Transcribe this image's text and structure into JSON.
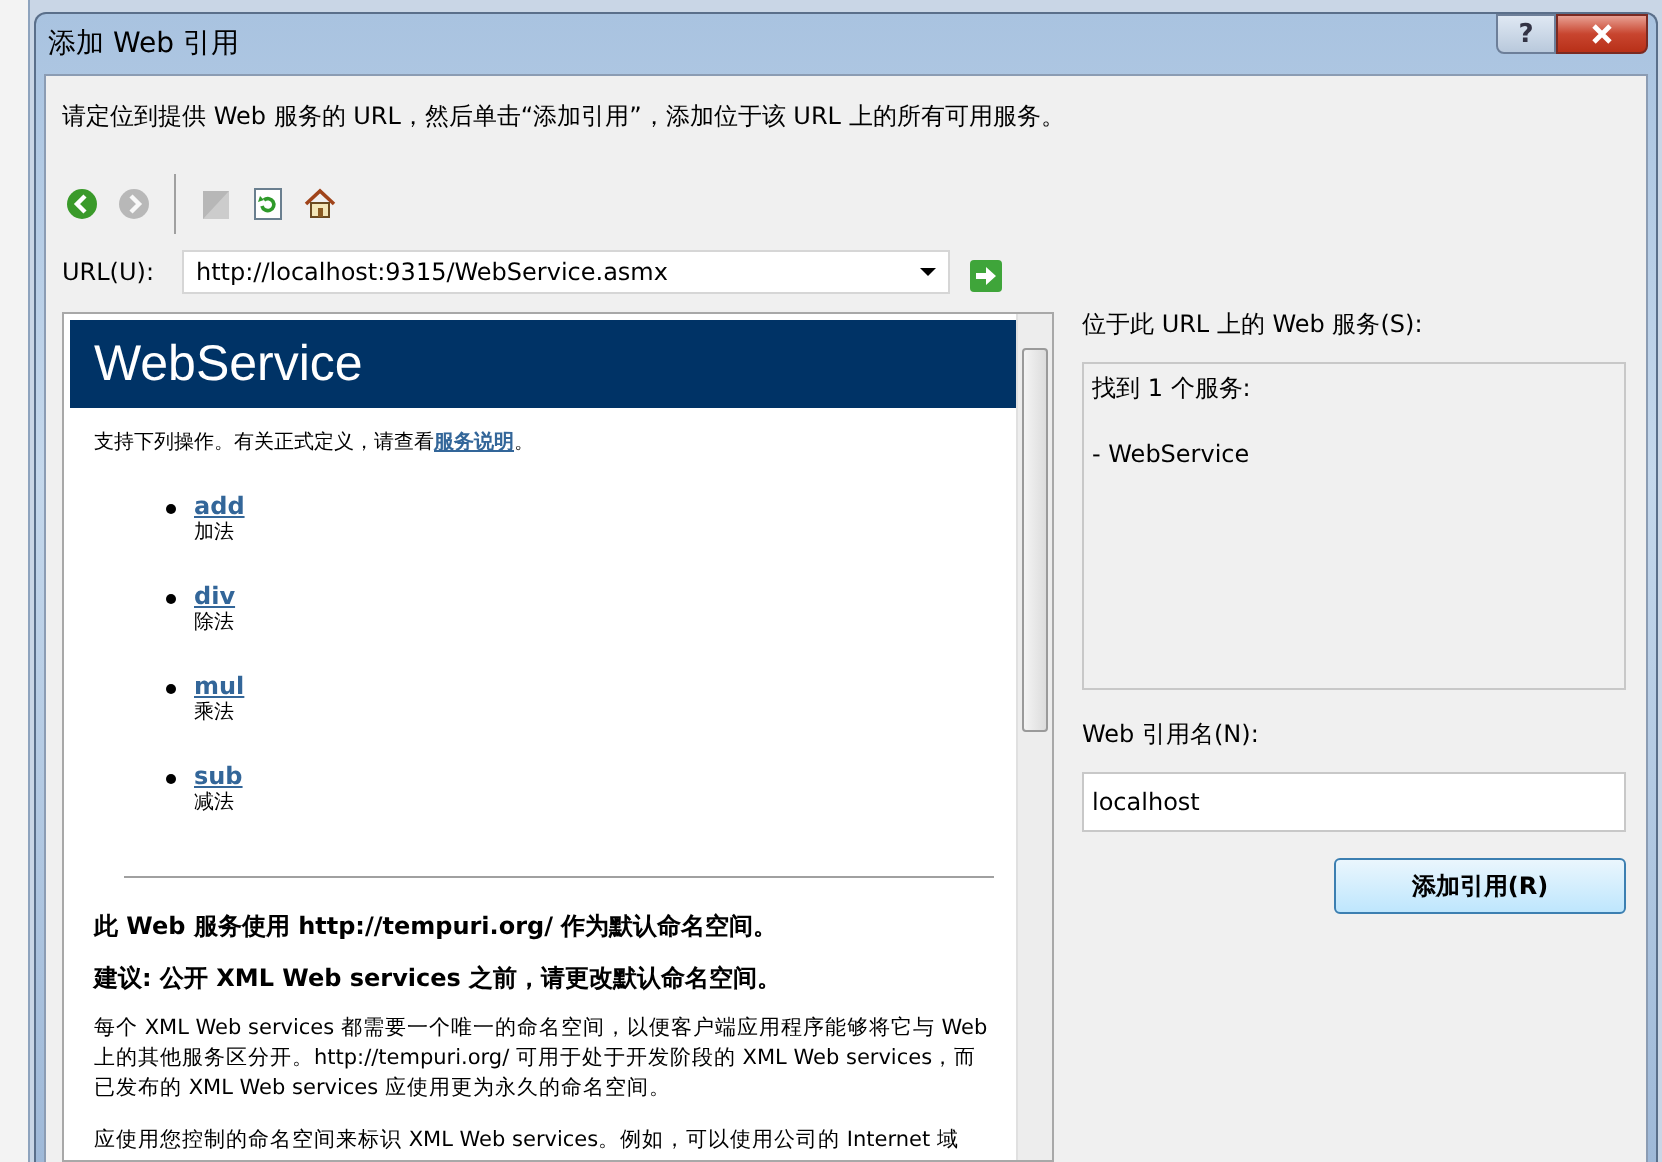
{
  "dialog": {
    "title": "添加 Web 引用",
    "help_button": "?",
    "instruction": "请定位到提供 Web 服务的 URL，然后单击“添加引用”，添加位于该 URL 上的所有可用服务。",
    "toolbar": [
      {
        "kind": "back",
        "disabled": false
      },
      {
        "kind": "forward",
        "disabled": true
      },
      {
        "kind": "separator"
      },
      {
        "kind": "stop",
        "disabled": true
      },
      {
        "kind": "refresh",
        "disabled": false
      },
      {
        "kind": "home",
        "disabled": false
      }
    ],
    "url": {
      "label": "URL(U):",
      "value": "http://localhost:9315/WebService.asmx"
    },
    "browser": {
      "heading": "WebService",
      "intro": "支持下列操作。有关正式定义，请查看",
      "intro_link": "服务说明",
      "intro_end": "。",
      "operations": [
        {
          "name": "add",
          "description": "加法"
        },
        {
          "name": "div",
          "description": "除法"
        },
        {
          "name": "mul",
          "description": "乘法"
        },
        {
          "name": "sub",
          "description": "减法"
        }
      ],
      "namespace_heading": "此  Web 服务使用  http://tempuri.org/ 作为默认命名空间。",
      "recommendation": "建议: 公开  XML Web services 之前，请更改默认命名空间。",
      "paragraphs": [
        "每个 XML Web services 都需要一个唯一的命名空间，以便客户端应用程序能够将它与 Web 上的其他服务区分开。http://tempuri.org/ 可用于处于开发阶段的 XML Web services，而已发布的 XML Web services 应使用更为永久的命名空间。",
        "应使用您控制的命名空间来标识 XML Web services。例如，可以使用公司的 Internet 域"
      ]
    },
    "services": {
      "label": "位于此 URL 上的 Web 服务(S):",
      "lines": [
        "找到 1 个服务:",
        "- WebService"
      ]
    },
    "reference_name": {
      "label": "Web 引用名(N):",
      "value": "localhost"
    },
    "add_button": "添加引用(R)"
  }
}
